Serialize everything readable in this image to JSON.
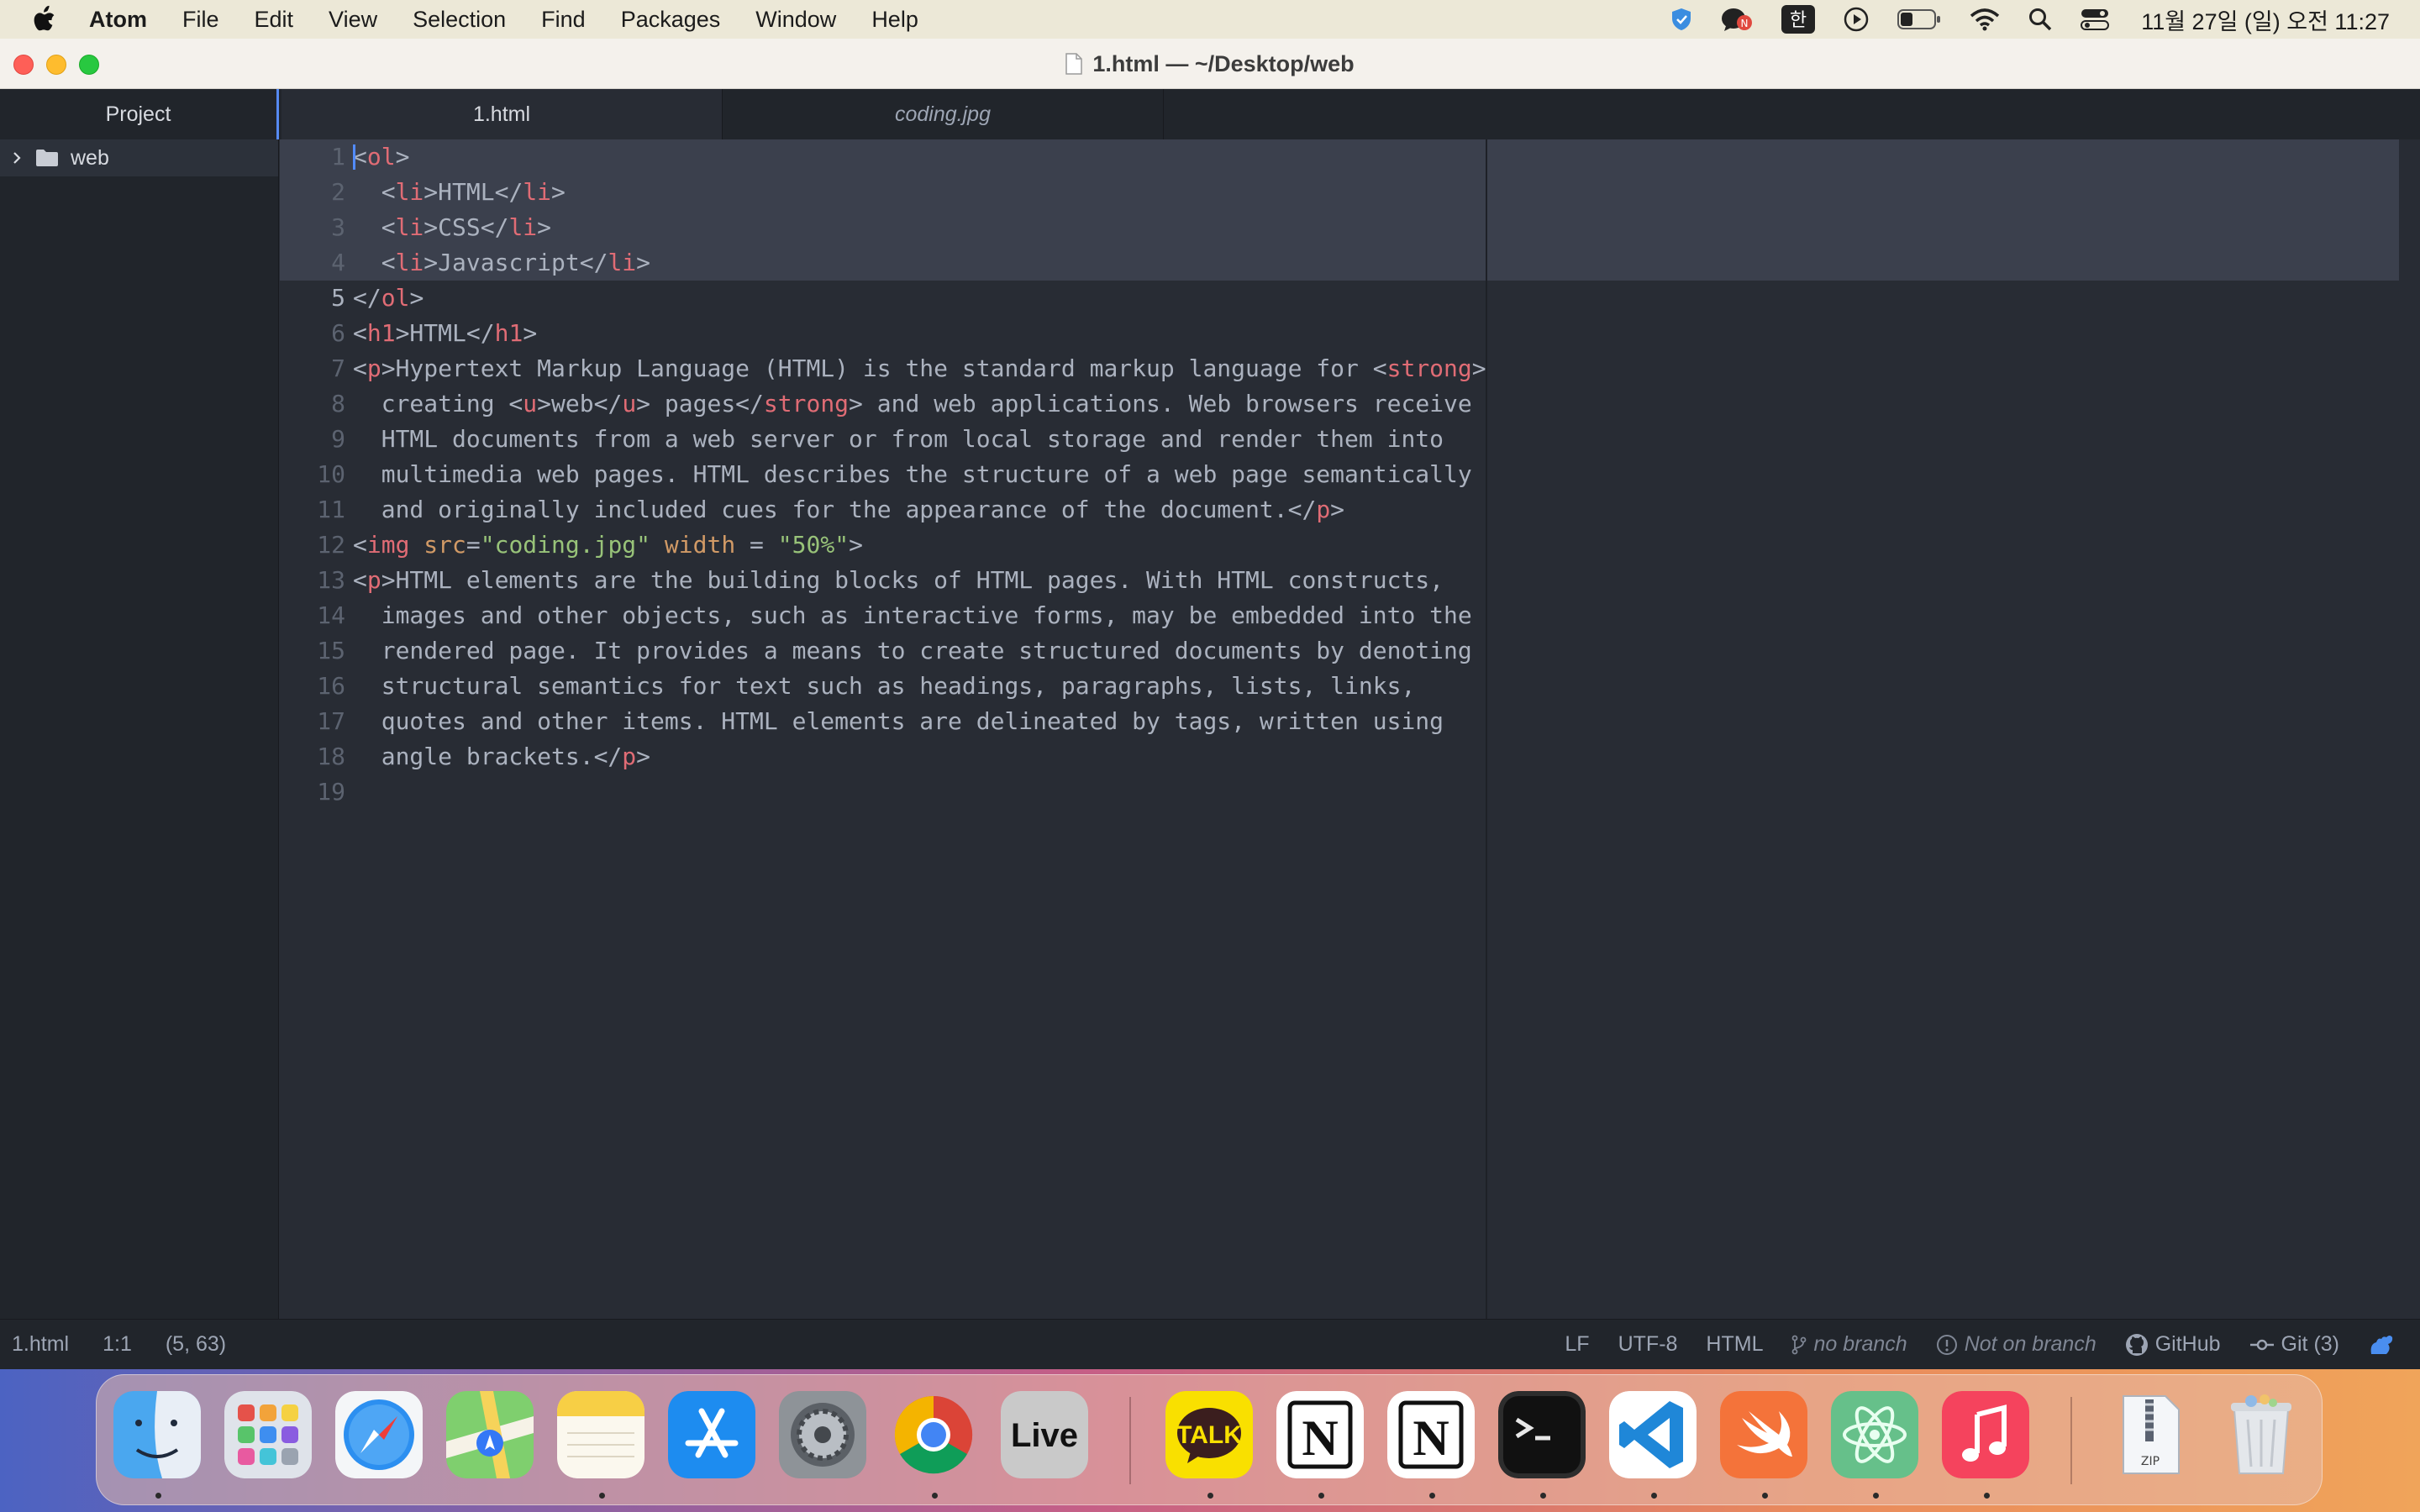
{
  "menubar": {
    "app_name": "Atom",
    "items": [
      "File",
      "Edit",
      "View",
      "Selection",
      "Find",
      "Packages",
      "Window",
      "Help"
    ],
    "input_method": "한",
    "clock": "11월 27일 (일) 오전 11:27",
    "status_icons": [
      "shield-icon",
      "chat-notification-icon",
      "input-method-icon",
      "play-icon",
      "battery-icon",
      "wifi-icon",
      "search-icon",
      "control-center-icon"
    ]
  },
  "window": {
    "title": "1.html — ~/Desktop/web"
  },
  "tabs": {
    "project": "Project",
    "items": [
      {
        "label": "1.html",
        "active": true
      },
      {
        "label": "coding.jpg",
        "active": false
      }
    ]
  },
  "tree": {
    "root": "web"
  },
  "editor": {
    "line_numbers": [
      "1",
      "2",
      "3",
      "4",
      "5",
      "6",
      "7",
      "8",
      "9",
      "10",
      "11",
      "12",
      "13",
      "14",
      "15",
      "16",
      "17",
      "18",
      "19"
    ],
    "lines": [
      "<ol>",
      "  <li>HTML</li>",
      "  <li>CSS</li>",
      "  <li>Javascript</li>",
      "</ol>",
      "<h1>HTML</h1>",
      "<p>Hypertext Markup Language (HTML) is the standard markup language for <strong>",
      "  creating <u>web</u> pages</strong> and web applications. Web browsers receive",
      "  HTML documents from a web server or from local storage and render them into",
      "  multimedia web pages. HTML describes the structure of a web page semantically",
      "  and originally included cues for the appearance of the document.</p>",
      "<img src=\"coding.jpg\" width = \"50%\">",
      "<p>HTML elements are the building blocks of HTML pages. With HTML constructs,",
      "  images and other objects, such as interactive forms, may be embedded into the",
      "  rendered page. It provides a means to create structured documents by denoting",
      "  structural semantics for text such as headings, paragraphs, lists, links,",
      "  quotes and other items. HTML elements are delineated by tags, written using",
      "  angle brackets.</p>",
      ""
    ]
  },
  "statusbar": {
    "file": "1.html",
    "cursor": "1:1",
    "selection": "(5, 63)",
    "line_ending": "LF",
    "encoding": "UTF-8",
    "grammar": "HTML",
    "branch": "no branch",
    "not_on_branch": "Not on branch",
    "github": "GitHub",
    "git": "Git (3)"
  },
  "dock": {
    "apps": [
      "Finder",
      "Launchpad",
      "Safari",
      "Maps",
      "Notes",
      "App Store",
      "System Preferences",
      "Chrome",
      "Live",
      "KakaoTalk",
      "Notion",
      "Notion",
      "Terminal",
      "Visual Studio Code",
      "Swift Playgrounds",
      "Atom",
      "Music",
      "Archive Utility",
      "Trash"
    ],
    "live_label": "Live",
    "talk_label": "TALK",
    "notion_label": "N",
    "zip_label": "ZIP"
  },
  "colors": {
    "editor_bg": "#282c34",
    "tag": "#e06c75",
    "attribute": "#d19a66",
    "string": "#98c379",
    "text": "#abb2bf",
    "accent": "#568af2"
  }
}
